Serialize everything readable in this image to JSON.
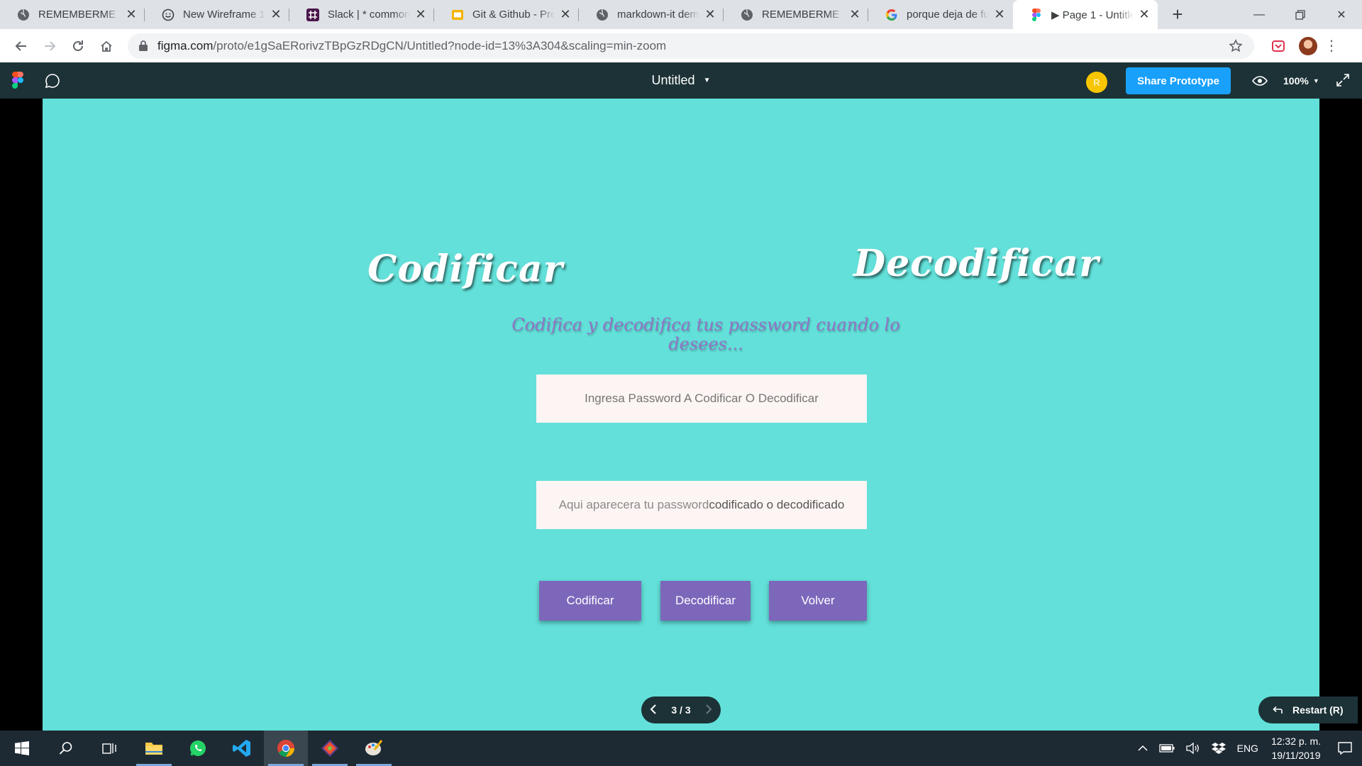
{
  "browser": {
    "tabs": [
      {
        "title": "REMEMBERME",
        "icon": "globe-icon"
      },
      {
        "title": "New Wireframe 1 | ",
        "icon": "smiley-icon"
      },
      {
        "title": "Slack | * commonc",
        "icon": "slack-icon"
      },
      {
        "title": "Git & Github - Pre",
        "icon": "slides-icon"
      },
      {
        "title": "markdown-it demo",
        "icon": "globe-icon"
      },
      {
        "title": "REMEMBERME",
        "icon": "globe-icon"
      },
      {
        "title": "porque deja de fun",
        "icon": "google-icon"
      },
      {
        "title": "▶ Page 1 - Untitled",
        "icon": "figma-icon",
        "active": true
      }
    ],
    "url_host": "figma.com",
    "url_path": "/proto/e1gSaERorivzTBpGzRDgCN/Untitled?node-id=13%3A304&scaling=min-zoom"
  },
  "figma": {
    "file_title": "Untitled",
    "avatar_initial": "R",
    "share_label": "Share Prototype",
    "zoom_label": "100%",
    "pager_label": "3 / 3",
    "restart_label": "Restart (R)"
  },
  "screen": {
    "heading_left": "Codificar",
    "heading_right": "Decodificar",
    "subtitle": "Codifica y decodifica tus password cuando lo desees...",
    "input_placeholder": "Ingresa Password A Codificar O Decodificar",
    "output_text_a": "Aqui aparecera tu password ",
    "output_text_b": "codificado o decodificado",
    "buttons": {
      "codificar": "Codificar",
      "decodificar": "Decodificar",
      "volver": "Volver"
    }
  },
  "taskbar": {
    "language": "ENG",
    "time": "12:32 p. m.",
    "date": "19/11/2019"
  },
  "colors": {
    "canvas": "#62e0d9",
    "button": "#7d67bb",
    "subtitle": "#9273c5",
    "share": "#18a0fb",
    "figma_bar": "#1c3236"
  }
}
